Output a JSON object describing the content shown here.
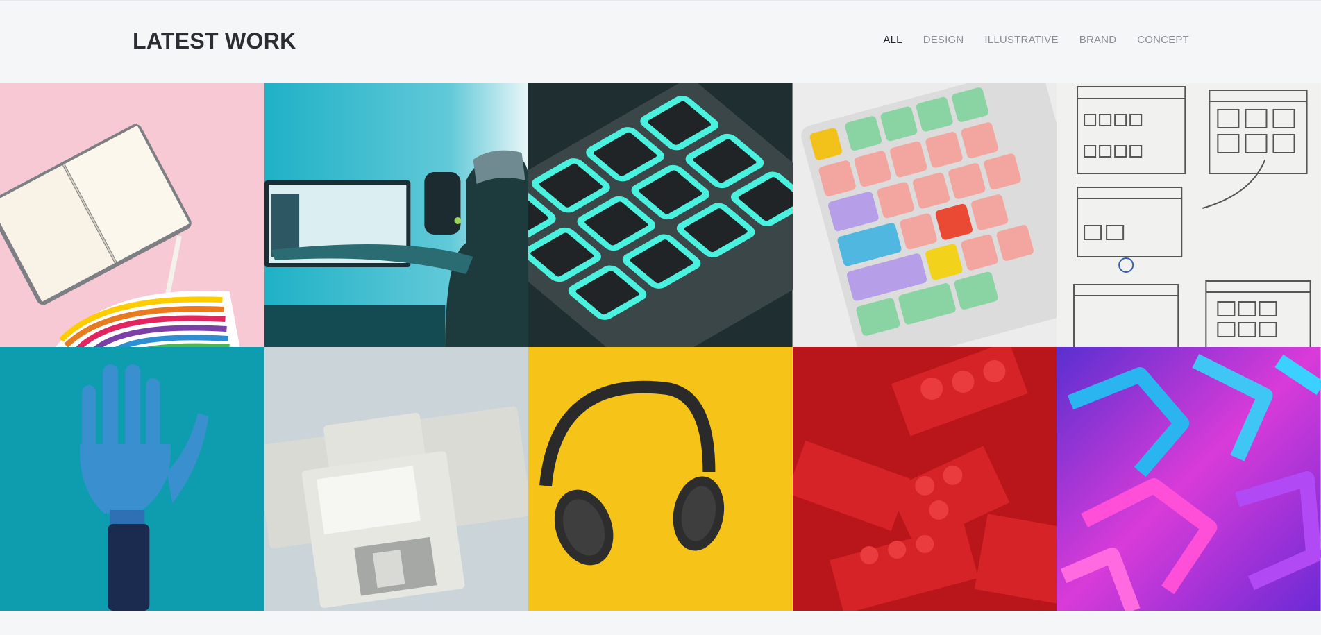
{
  "header": {
    "title": "LATEST WORK",
    "filters": [
      {
        "label": "ALL",
        "active": true
      },
      {
        "label": "DESIGN",
        "active": false
      },
      {
        "label": "ILLUSTRATIVE",
        "active": false
      },
      {
        "label": "BRAND",
        "active": false
      },
      {
        "label": "CONCEPT",
        "active": false
      }
    ]
  },
  "portfolio": {
    "items": [
      {
        "subject": "notebook-and-color-swatches",
        "bg": "#f7c8d4"
      },
      {
        "subject": "person-at-computer-monitor",
        "bg": "#27b6c9"
      },
      {
        "subject": "glowing-drum-pad",
        "bg": "#1c2a2c"
      },
      {
        "subject": "colorful-keyboard",
        "bg": "#ebebeb"
      },
      {
        "subject": "ui-wireframe-sketches",
        "bg": "#f1f1f0"
      },
      {
        "subject": "robotic-hand",
        "bg": "#0f9fb0"
      },
      {
        "subject": "floppy-disks",
        "bg": "#cdd5da"
      },
      {
        "subject": "headphones-on-yellow",
        "bg": "#f5c518"
      },
      {
        "subject": "red-lego-bricks",
        "bg": "#c4191c"
      },
      {
        "subject": "abstract-neon-3d-shapes",
        "bg": "#9b3ad9"
      }
    ]
  }
}
